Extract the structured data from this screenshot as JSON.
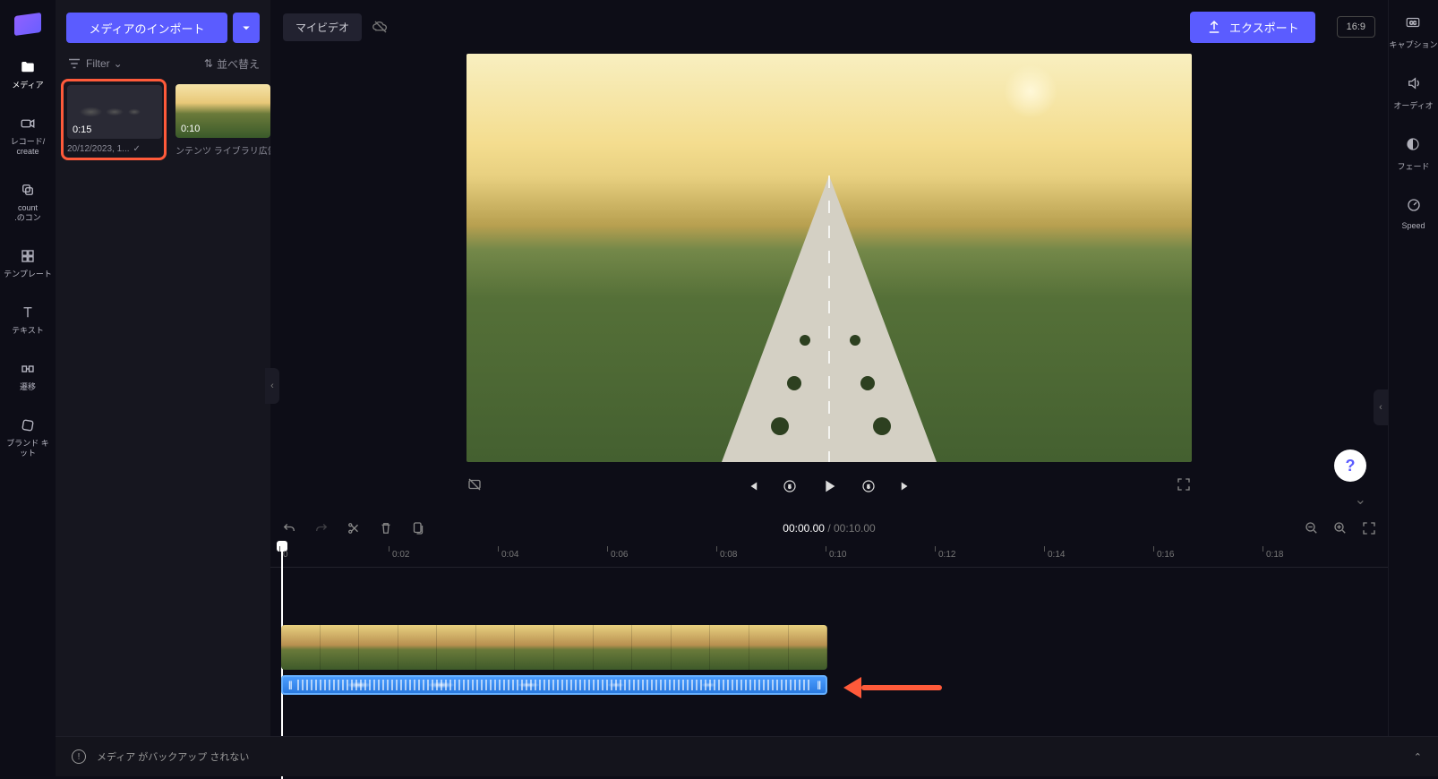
{
  "sidebar": {
    "items": [
      {
        "label": "メディア"
      },
      {
        "label": "レコード/\ncreate"
      },
      {
        "label": "count\n.のコン"
      },
      {
        "label": "テンプレート"
      },
      {
        "label": "テキスト"
      },
      {
        "label": "遷移"
      },
      {
        "label": "ブランド キット"
      }
    ]
  },
  "mediaPanel": {
    "importLabel": "メディアのインポート",
    "filterLabel": "Filter",
    "sortLabel": "並べ替え",
    "clips": [
      {
        "duration": "0:15",
        "caption": "20/12/2023, 1..."
      },
      {
        "duration": "0:10",
        "caption": "ンテンツ ライブラリ広告。"
      }
    ]
  },
  "topBar": {
    "projectName": "マイビデオ",
    "exportLabel": "エクスポート",
    "aspect": "16:9"
  },
  "rightSidebar": {
    "items": [
      {
        "label": "キャプション"
      },
      {
        "label": "オーディオ"
      },
      {
        "label": "フェード"
      },
      {
        "label": "Speed"
      }
    ]
  },
  "transport": {
    "currentTime": "00:00.00",
    "separator": " / ",
    "totalTime": "00:10.00"
  },
  "ruler": {
    "ticks": [
      "0",
      "0:02",
      "0:04",
      "0:06",
      "0:08",
      "0:10",
      "0:12",
      "0:14",
      "0:16",
      "0:18"
    ]
  },
  "footer": {
    "warning": "メディア がバックアップ されない"
  },
  "help": "?"
}
